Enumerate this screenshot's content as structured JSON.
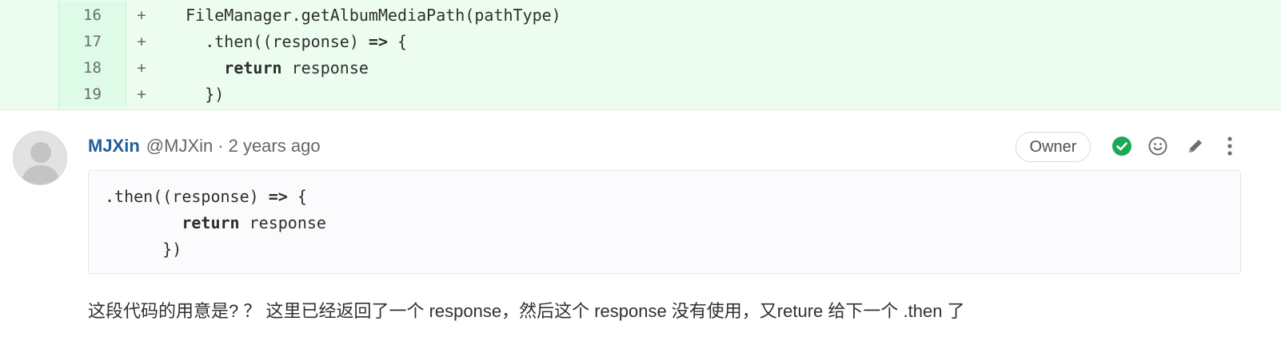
{
  "diff": {
    "lines": [
      {
        "num": "16",
        "sign": "+",
        "indent": "   ",
        "pre": "",
        "keyword": "",
        "post": "FileManager.getAlbumMediaPath(pathType)"
      },
      {
        "num": "17",
        "sign": "+",
        "indent": "     ",
        "pre": ".then((response) ",
        "keyword": "=>",
        "post": " {"
      },
      {
        "num": "18",
        "sign": "+",
        "indent": "       ",
        "pre": "",
        "keyword": "return",
        "post": " response"
      },
      {
        "num": "19",
        "sign": "+",
        "indent": "     ",
        "pre": "",
        "keyword": "",
        "post": "})"
      }
    ]
  },
  "comment": {
    "author": "MJXin",
    "handle": "@MJXin",
    "separator": "·",
    "time": "2 years ago",
    "role_badge": "Owner",
    "code": {
      "line1_pre": ".then((response) ",
      "line1_kw": "=>",
      "line1_post": " {",
      "line2_indent": "        ",
      "line2_kw": "return",
      "line2_post": " response",
      "line3": "      })"
    },
    "body": "这段代码的用意是? ？ 这里已经返回了一个 response，然后这个 response 没有使用，又reture 给下一个 .then 了"
  },
  "icons": {
    "resolve": "check-circle-icon",
    "emoji": "smiley-icon",
    "edit": "pencil-icon",
    "more": "vertical-ellipsis-icon"
  },
  "colors": {
    "author": "#1f5f99",
    "diff_added_bg": "#ecfdf0",
    "resolved_green": "#1aaa55"
  }
}
